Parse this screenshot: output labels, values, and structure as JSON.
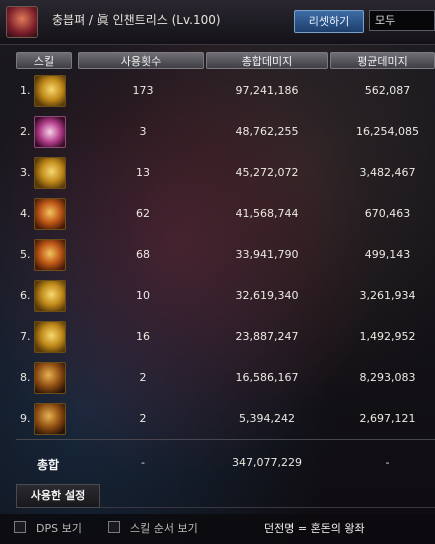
{
  "header": {
    "title": "충븝펴 / 眞 인챈트리스 (Lv.100)",
    "reset_label": "리셋하기",
    "filter_value": "모두"
  },
  "table": {
    "columns": [
      "스킬",
      "사용횟수",
      "총합데미지",
      "평균데미지"
    ],
    "rows": [
      {
        "rank": "1.",
        "icon": "skill-icon",
        "count": "173",
        "total": "97,241,186",
        "avg": "562,087"
      },
      {
        "rank": "2.",
        "icon": "skill-icon",
        "count": "3",
        "total": "48,762,255",
        "avg": "16,254,085"
      },
      {
        "rank": "3.",
        "icon": "skill-icon",
        "count": "13",
        "total": "45,272,072",
        "avg": "3,482,467"
      },
      {
        "rank": "4.",
        "icon": "skill-icon",
        "count": "62",
        "total": "41,568,744",
        "avg": "670,463"
      },
      {
        "rank": "5.",
        "icon": "skill-icon",
        "count": "68",
        "total": "33,941,790",
        "avg": "499,143"
      },
      {
        "rank": "6.",
        "icon": "skill-icon",
        "count": "10",
        "total": "32,619,340",
        "avg": "3,261,934"
      },
      {
        "rank": "7.",
        "icon": "skill-icon",
        "count": "16",
        "total": "23,887,247",
        "avg": "1,492,952"
      },
      {
        "rank": "8.",
        "icon": "skill-icon",
        "count": "2",
        "total": "16,586,167",
        "avg": "8,293,083"
      },
      {
        "rank": "9.",
        "icon": "skill-icon",
        "count": "2",
        "total": "5,394,242",
        "avg": "2,697,121"
      }
    ],
    "total": {
      "label": "총합",
      "count": "-",
      "damage": "347,077,229",
      "avg": "-"
    }
  },
  "settings_tab_label": "사용한 설정",
  "footer": {
    "dps_label": "DPS 보기",
    "skill_order_label": "스킬 순서 보기",
    "dungeon_label": "던전명 = 혼돈의 왕좌"
  }
}
